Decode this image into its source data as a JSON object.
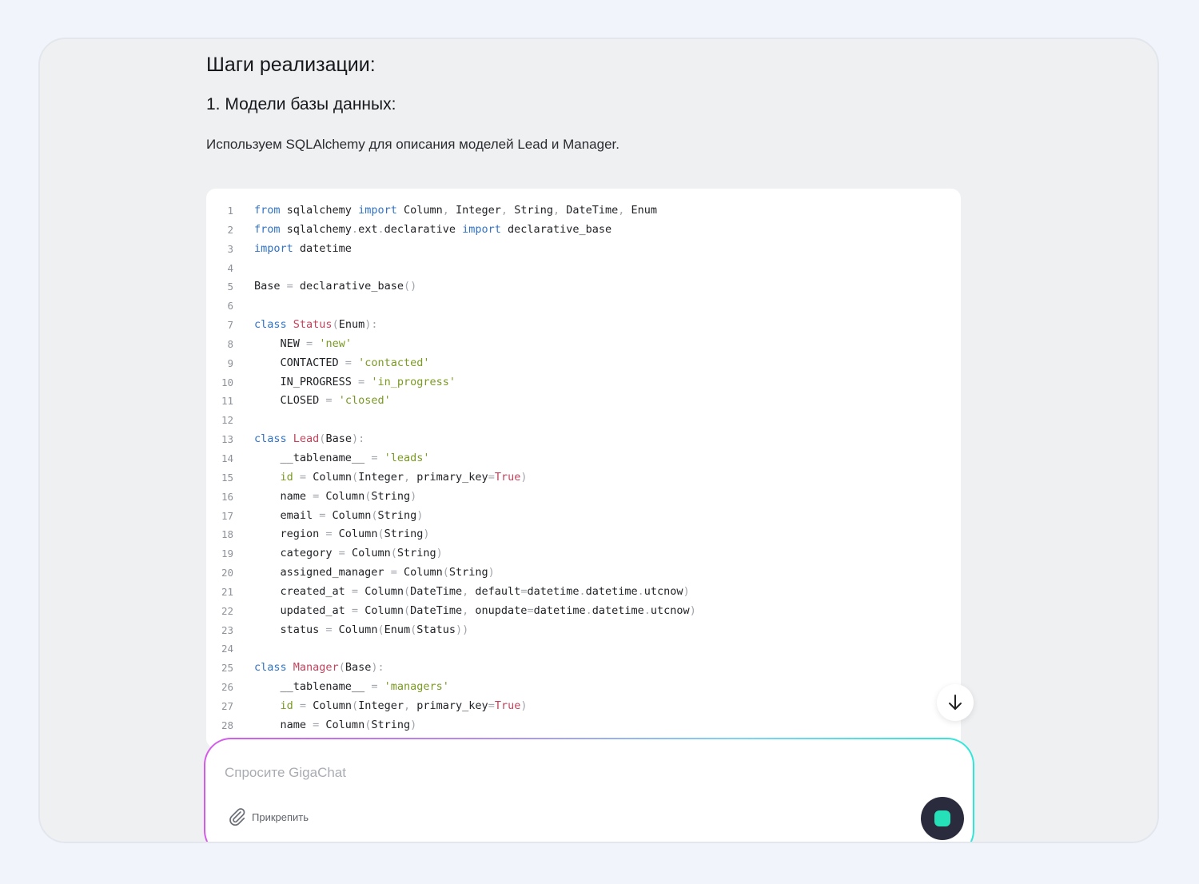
{
  "content": {
    "heading": "Шаги реализации:",
    "subheading": "1. Модели базы данных:",
    "paragraph": "Используем SQLAlchemy для описания моделей Lead и Manager."
  },
  "code": {
    "language": "python",
    "lines": [
      [
        [
          "kw",
          "from"
        ],
        [
          "t",
          " sqlalchemy "
        ],
        [
          "kw",
          "import"
        ],
        [
          "t",
          " Column"
        ],
        [
          "pn",
          ","
        ],
        [
          "t",
          " Integer"
        ],
        [
          "pn",
          ","
        ],
        [
          "t",
          " String"
        ],
        [
          "pn",
          ","
        ],
        [
          "t",
          " DateTime"
        ],
        [
          "pn",
          ","
        ],
        [
          "t",
          " Enum"
        ]
      ],
      [
        [
          "kw",
          "from"
        ],
        [
          "t",
          " sqlalchemy"
        ],
        [
          "pn",
          "."
        ],
        [
          "t",
          "ext"
        ],
        [
          "pn",
          "."
        ],
        [
          "t",
          "declarative "
        ],
        [
          "kw",
          "import"
        ],
        [
          "t",
          " declarative_base"
        ]
      ],
      [
        [
          "kw",
          "import"
        ],
        [
          "t",
          " datetime"
        ]
      ],
      [],
      [
        [
          "t",
          "Base "
        ],
        [
          "pn",
          "="
        ],
        [
          "t",
          " declarative_base"
        ],
        [
          "pn",
          "()"
        ]
      ],
      [],
      [
        [
          "kw",
          "class"
        ],
        [
          "t",
          " "
        ],
        [
          "cls",
          "Status"
        ],
        [
          "pn",
          "("
        ],
        [
          "t",
          "Enum"
        ],
        [
          "pn",
          "):"
        ]
      ],
      [
        [
          "t",
          "    NEW "
        ],
        [
          "pn",
          "="
        ],
        [
          "t",
          " "
        ],
        [
          "str",
          "'new'"
        ]
      ],
      [
        [
          "t",
          "    CONTACTED "
        ],
        [
          "pn",
          "="
        ],
        [
          "t",
          " "
        ],
        [
          "str",
          "'contacted'"
        ]
      ],
      [
        [
          "t",
          "    IN_PROGRESS "
        ],
        [
          "pn",
          "="
        ],
        [
          "t",
          " "
        ],
        [
          "str",
          "'in_progress'"
        ]
      ],
      [
        [
          "t",
          "    CLOSED "
        ],
        [
          "pn",
          "="
        ],
        [
          "t",
          " "
        ],
        [
          "str",
          "'closed'"
        ]
      ],
      [],
      [
        [
          "kw",
          "class"
        ],
        [
          "t",
          " "
        ],
        [
          "cls",
          "Lead"
        ],
        [
          "pn",
          "("
        ],
        [
          "t",
          "Base"
        ],
        [
          "pn",
          "):"
        ]
      ],
      [
        [
          "t",
          "    __tablename__ "
        ],
        [
          "pn",
          "="
        ],
        [
          "t",
          " "
        ],
        [
          "str",
          "'leads'"
        ]
      ],
      [
        [
          "t",
          "    "
        ],
        [
          "num-id",
          "id"
        ],
        [
          "t",
          " "
        ],
        [
          "pn",
          "="
        ],
        [
          "t",
          " Column"
        ],
        [
          "pn",
          "("
        ],
        [
          "t",
          "Integer"
        ],
        [
          "pn",
          ","
        ],
        [
          "t",
          " primary_key"
        ],
        [
          "pn",
          "="
        ],
        [
          "bool",
          "True"
        ],
        [
          "pn",
          ")"
        ]
      ],
      [
        [
          "t",
          "    name "
        ],
        [
          "pn",
          "="
        ],
        [
          "t",
          " Column"
        ],
        [
          "pn",
          "("
        ],
        [
          "t",
          "String"
        ],
        [
          "pn",
          ")"
        ]
      ],
      [
        [
          "t",
          "    email "
        ],
        [
          "pn",
          "="
        ],
        [
          "t",
          " Column"
        ],
        [
          "pn",
          "("
        ],
        [
          "t",
          "String"
        ],
        [
          "pn",
          ")"
        ]
      ],
      [
        [
          "t",
          "    region "
        ],
        [
          "pn",
          "="
        ],
        [
          "t",
          " Column"
        ],
        [
          "pn",
          "("
        ],
        [
          "t",
          "String"
        ],
        [
          "pn",
          ")"
        ]
      ],
      [
        [
          "t",
          "    category "
        ],
        [
          "pn",
          "="
        ],
        [
          "t",
          " Column"
        ],
        [
          "pn",
          "("
        ],
        [
          "t",
          "String"
        ],
        [
          "pn",
          ")"
        ]
      ],
      [
        [
          "t",
          "    assigned_manager "
        ],
        [
          "pn",
          "="
        ],
        [
          "t",
          " Column"
        ],
        [
          "pn",
          "("
        ],
        [
          "t",
          "String"
        ],
        [
          "pn",
          ")"
        ]
      ],
      [
        [
          "t",
          "    created_at "
        ],
        [
          "pn",
          "="
        ],
        [
          "t",
          " Column"
        ],
        [
          "pn",
          "("
        ],
        [
          "t",
          "DateTime"
        ],
        [
          "pn",
          ","
        ],
        [
          "t",
          " default"
        ],
        [
          "pn",
          "="
        ],
        [
          "t",
          "datetime"
        ],
        [
          "pn",
          "."
        ],
        [
          "t",
          "datetime"
        ],
        [
          "pn",
          "."
        ],
        [
          "t",
          "utcnow"
        ],
        [
          "pn",
          ")"
        ]
      ],
      [
        [
          "t",
          "    updated_at "
        ],
        [
          "pn",
          "="
        ],
        [
          "t",
          " Column"
        ],
        [
          "pn",
          "("
        ],
        [
          "t",
          "DateTime"
        ],
        [
          "pn",
          ","
        ],
        [
          "t",
          " onupdate"
        ],
        [
          "pn",
          "="
        ],
        [
          "t",
          "datetime"
        ],
        [
          "pn",
          "."
        ],
        [
          "t",
          "datetime"
        ],
        [
          "pn",
          "."
        ],
        [
          "t",
          "utcnow"
        ],
        [
          "pn",
          ")"
        ]
      ],
      [
        [
          "t",
          "    status "
        ],
        [
          "pn",
          "="
        ],
        [
          "t",
          " Column"
        ],
        [
          "pn",
          "("
        ],
        [
          "t",
          "Enum"
        ],
        [
          "pn",
          "("
        ],
        [
          "t",
          "Status"
        ],
        [
          "pn",
          "))"
        ]
      ],
      [],
      [
        [
          "kw",
          "class"
        ],
        [
          "t",
          " "
        ],
        [
          "cls",
          "Manager"
        ],
        [
          "pn",
          "("
        ],
        [
          "t",
          "Base"
        ],
        [
          "pn",
          "):"
        ]
      ],
      [
        [
          "t",
          "    __tablename__ "
        ],
        [
          "pn",
          "="
        ],
        [
          "t",
          " "
        ],
        [
          "str",
          "'managers'"
        ]
      ],
      [
        [
          "t",
          "    "
        ],
        [
          "num-id",
          "id"
        ],
        [
          "t",
          " "
        ],
        [
          "pn",
          "="
        ],
        [
          "t",
          " Column"
        ],
        [
          "pn",
          "("
        ],
        [
          "t",
          "Integer"
        ],
        [
          "pn",
          ","
        ],
        [
          "t",
          " primary_key"
        ],
        [
          "pn",
          "="
        ],
        [
          "bool",
          "True"
        ],
        [
          "pn",
          ")"
        ]
      ],
      [
        [
          "t",
          "    name "
        ],
        [
          "pn",
          "="
        ],
        [
          "t",
          " Column"
        ],
        [
          "pn",
          "("
        ],
        [
          "t",
          "String"
        ],
        [
          "pn",
          ")"
        ]
      ]
    ]
  },
  "composer": {
    "placeholder": "Спросите GigaChat",
    "attach_label": "Прикрепить",
    "attach_icon": "paperclip-icon",
    "send_icon": "stop-icon"
  },
  "scroll_down_icon": "arrow-down-icon",
  "colors": {
    "keyword": "#2f73c9",
    "class_name": "#c0435c",
    "string": "#7a9a22",
    "send_button": "#2a2c3e",
    "stop_square": "#25e0b8"
  }
}
